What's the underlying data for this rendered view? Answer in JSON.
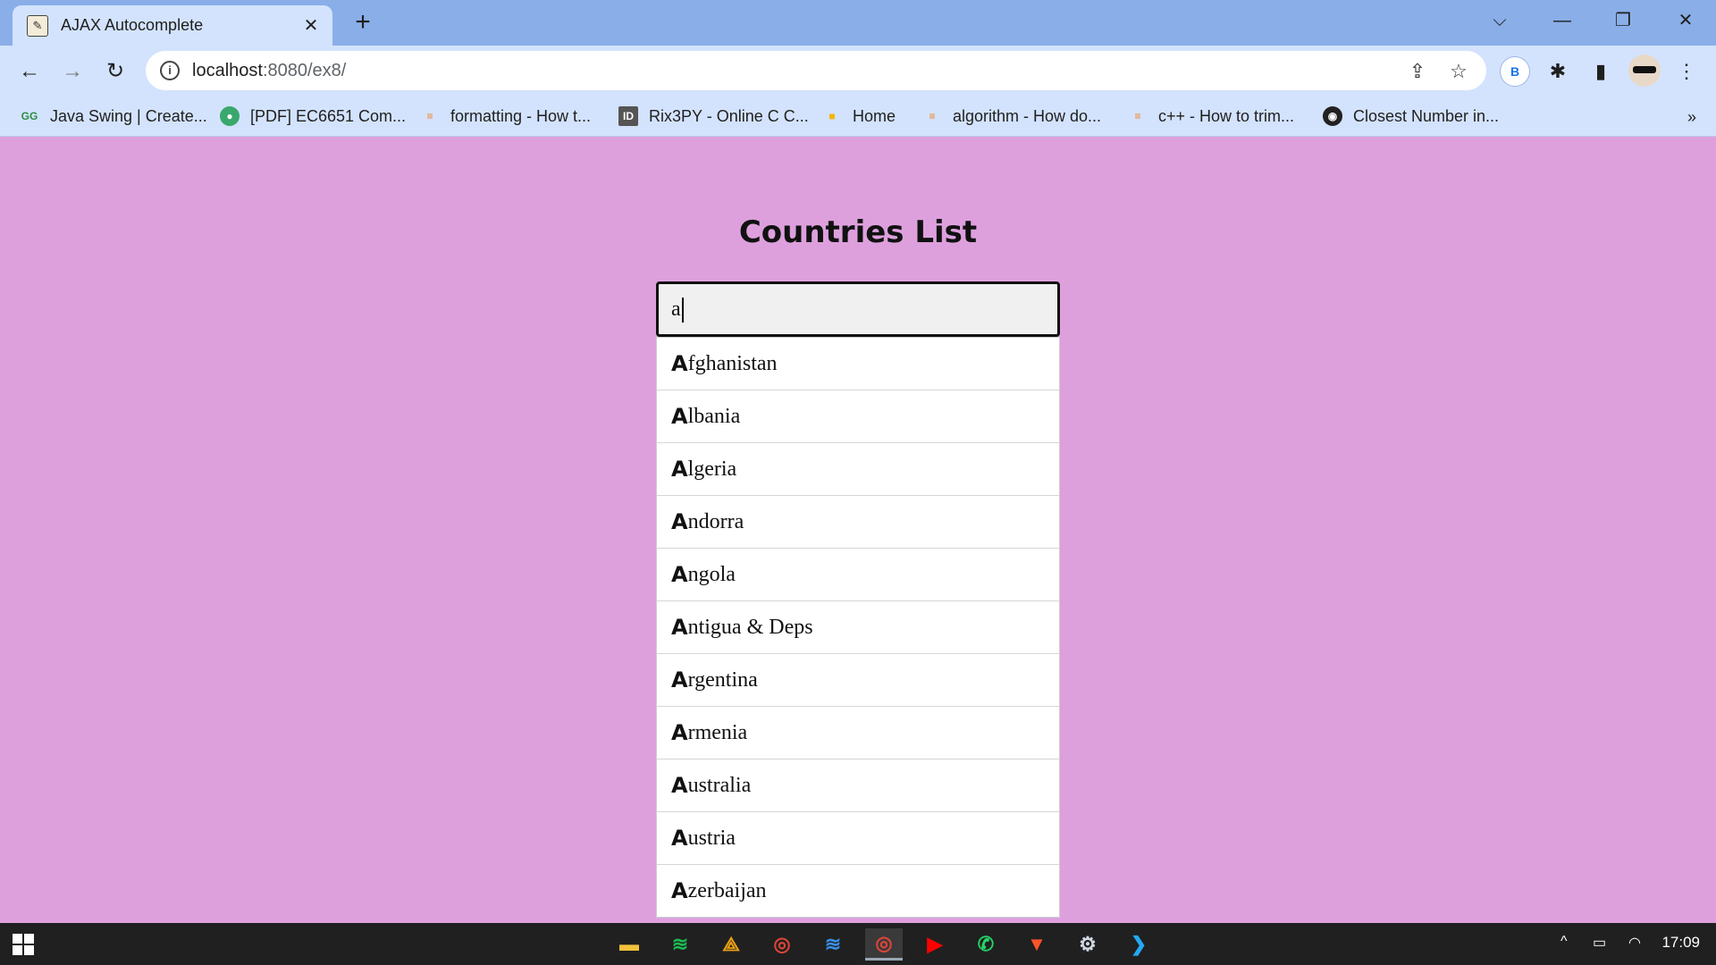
{
  "browser": {
    "tab_title": "AJAX Autocomplete",
    "tab_close": "✕",
    "new_tab": "+",
    "url_host": "localhost",
    "url_rest": ":8080/ex8/",
    "profile_letter": "B",
    "window_controls": {
      "dropdown": "⌵",
      "minimize": "—",
      "restore": "❐",
      "close": "✕"
    },
    "nav": {
      "back": "←",
      "forward": "→",
      "reload": "↻"
    },
    "toolbar_icons": {
      "share": "⇪",
      "star": "☆",
      "extensions": "✱",
      "sidepanel": "▮",
      "menu": "⋮"
    }
  },
  "bookmarks": [
    {
      "label": "Java Swing | Create...",
      "icon": "gfg-icon",
      "color": "#2f8d46",
      "glyph": "GG"
    },
    {
      "label": "[PDF] EC6651 Com...",
      "icon": "globe-color-icon",
      "color": "#3aa76d",
      "glyph": "●"
    },
    {
      "label": "formatting - How t...",
      "icon": "stackoverflow-icon",
      "color": "#f48024",
      "glyph": "≡"
    },
    {
      "label": "Rix3PY - Online C C...",
      "icon": "ideone-icon",
      "color": "#555555",
      "glyph": "ID"
    },
    {
      "label": "Home",
      "icon": "box-icon",
      "color": "#f5b400",
      "glyph": "■"
    },
    {
      "label": "algorithm - How do...",
      "icon": "stackoverflow-icon",
      "color": "#f48024",
      "glyph": "≡"
    },
    {
      "label": "c++ - How to trim...",
      "icon": "stackoverflow-icon",
      "color": "#f48024",
      "glyph": "≡"
    },
    {
      "label": "Closest Number in...",
      "icon": "globe-icon",
      "color": "#222222",
      "glyph": "◉"
    }
  ],
  "bookmarks_more": "»",
  "page": {
    "title": "Countries List",
    "search_value": "a",
    "suggestions": [
      {
        "first": "A",
        "rest": "fghanistan"
      },
      {
        "first": "A",
        "rest": "lbania"
      },
      {
        "first": "A",
        "rest": "lgeria"
      },
      {
        "first": "A",
        "rest": "ndorra"
      },
      {
        "first": "A",
        "rest": "ngola"
      },
      {
        "first": "A",
        "rest": "ntigua & Deps"
      },
      {
        "first": "A",
        "rest": "rgentina"
      },
      {
        "first": "A",
        "rest": "rmenia"
      },
      {
        "first": "A",
        "rest": "ustralia"
      },
      {
        "first": "A",
        "rest": "ustria"
      },
      {
        "first": "A",
        "rest": "zerbaijan"
      }
    ],
    "background_color": "#dda0dd"
  },
  "taskbar": {
    "apps": [
      {
        "name": "file-explorer-icon",
        "glyph": "▬",
        "color": "#f3c13a",
        "active": false
      },
      {
        "name": "spotify-icon",
        "glyph": "≋",
        "color": "#1db954",
        "active": false
      },
      {
        "name": "matlab-icon",
        "glyph": "⟁",
        "color": "#e9a016",
        "active": false
      },
      {
        "name": "chrome-icon",
        "glyph": "◎",
        "color": "#db4437",
        "active": false
      },
      {
        "name": "music-app-icon",
        "glyph": "≋",
        "color": "#3a8ee6",
        "active": false
      },
      {
        "name": "chrome-active-icon",
        "glyph": "◎",
        "color": "#db4437",
        "active": true
      },
      {
        "name": "youtube-icon",
        "glyph": "▶",
        "color": "#ff0000",
        "active": false
      },
      {
        "name": "whatsapp-icon",
        "glyph": "✆",
        "color": "#25d366",
        "active": false
      },
      {
        "name": "brave-icon",
        "glyph": "▼",
        "color": "#fb542b",
        "active": false
      },
      {
        "name": "settings-icon",
        "glyph": "⚙",
        "color": "#cfd8e3",
        "active": false
      },
      {
        "name": "vscode-icon",
        "glyph": "❯",
        "color": "#23a9f2",
        "active": false
      }
    ],
    "clock": "17:09",
    "tray_chevron": "^",
    "tray_battery": "▭",
    "tray_wifi": "◠"
  }
}
